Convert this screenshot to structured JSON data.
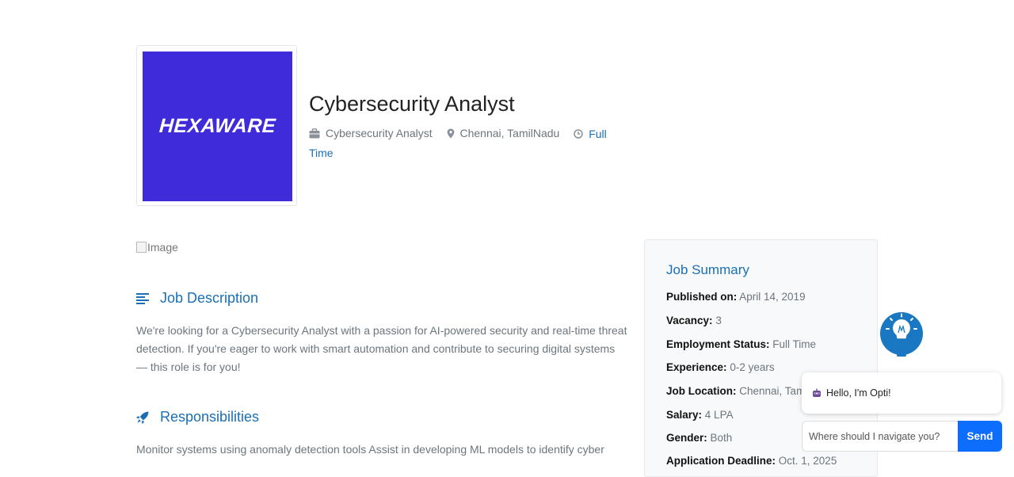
{
  "company": {
    "logo_text": "HEXAWARE",
    "brand_color": "#3f2bd9"
  },
  "job": {
    "title": "Cybersecurity Analyst",
    "category": "Cybersecurity Analyst",
    "location": "Chennai, TamilNadu",
    "type_line1": "Full",
    "type_line2": "Time"
  },
  "image_alt": "Image",
  "description": {
    "heading": "Job Description",
    "text": "We're looking for a Cybersecurity Analyst with a passion for AI-powered security and real-time threat detection. If you're eager to work with smart automation and contribute to securing digital systems — this role is for you!"
  },
  "responsibilities": {
    "heading": "Responsibilities",
    "text": "Monitor systems using anomaly detection tools Assist in developing ML models to identify cyber"
  },
  "summary": {
    "heading": "Job Summary",
    "rows": [
      {
        "label": "Published on:",
        "value": "April 14, 2019"
      },
      {
        "label": "Vacancy:",
        "value": "3"
      },
      {
        "label": "Employment Status:",
        "value": "Full Time"
      },
      {
        "label": "Experience:",
        "value": "0-2 years"
      },
      {
        "label": "Job Location:",
        "value": "Chennai, Tami"
      },
      {
        "label": "Salary:",
        "value": "4 LPA"
      },
      {
        "label": "Gender:",
        "value": "Both"
      },
      {
        "label": "Application Deadline:",
        "value": "Oct. 1, 2025"
      }
    ]
  },
  "chatbot": {
    "greeting": "Hello, I'm Opti!",
    "placeholder": "Where should I navigate you?",
    "send_label": "Send",
    "accent": "#0d6efd"
  },
  "colors": {
    "link": "#1a6fb5",
    "text": "#6c757d"
  }
}
